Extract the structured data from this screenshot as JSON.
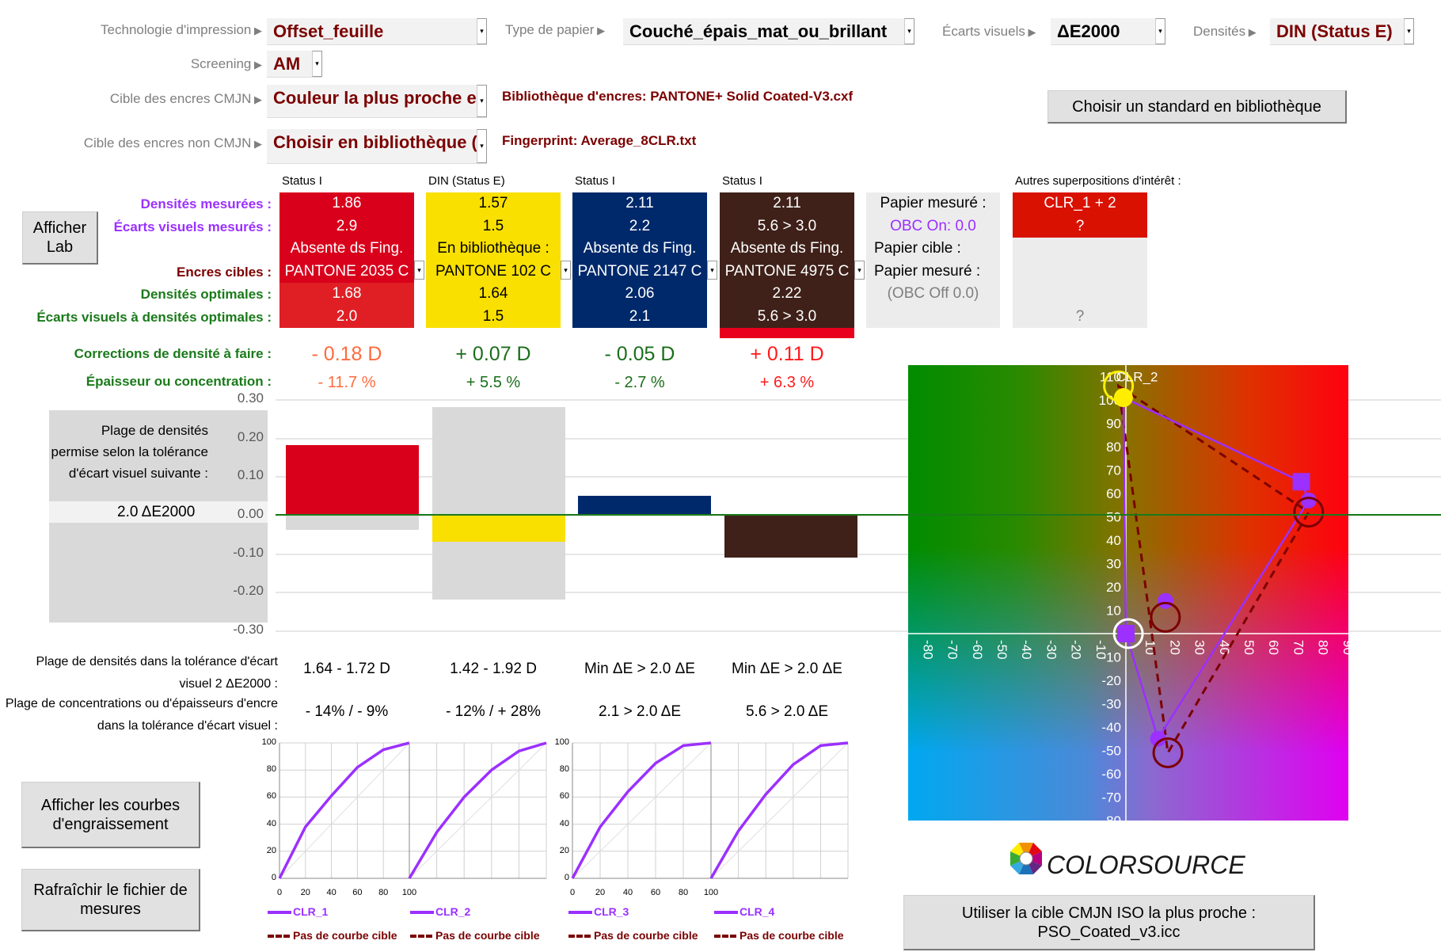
{
  "settings": {
    "tech_label": "Technologie d'impression",
    "tech_value": "Offset_feuille",
    "paper_label": "Type de papier",
    "paper_value": "Couché_épais_mat_ou_brillant",
    "dev_label": "Écarts visuels",
    "dev_value": "ΔE2000",
    "dens_label": "Densités",
    "dens_value": "DIN (Status E)",
    "screen_label": "Screening",
    "screen_value": "AM",
    "cmyk_label": "Cible des encres CMJN",
    "cmyk_value": "Couleur la plus proche e",
    "noncmyk_label": "Cible des encres non CMJN",
    "noncmyk_value": "Choisir en bibliothèque (",
    "library_text": "Bibliothèque d'encres:  PANTONE+ Solid Coated-V3.cxf",
    "fingerprint_text": "Fingerprint: Average_8CLR.txt",
    "choose_standard_button": "Choisir un standard en bibliothèque"
  },
  "buttons": {
    "show_lab": "Afficher Lab",
    "show_curves": "Afficher les courbes d'engraissement",
    "refresh": "Rafraîchir le fichier de mesures",
    "use_iso": "Utiliser la cible CMJN ISO la plus proche : PSO_Coated_v3.icc"
  },
  "row_labels": {
    "measured_density": "Densités mesurées :",
    "measured_dev": "Écarts visuels mesurés :",
    "target_inks": "Encres cibles :",
    "optimal_density": "Densités optimales :",
    "optimal_dev": "Écarts visuels à densités optimales :",
    "corrections": "Corrections de densité à faire :",
    "thickness": "Épaisseur ou concentration :",
    "density_range": "Plage de densités dans la tolérance d'écart visuel 2 ΔE2000 :",
    "conc_range": "Plage de concentrations ou d'épaisseurs d'encre dans la tolérance d'écart visuel :"
  },
  "inks": [
    {
      "status": "Status I",
      "measured_density": "1.86",
      "measured_dev": "2.9",
      "lib_status": "Absente ds Fing.",
      "target": "PANTONE 2035 C",
      "optimal_density": "1.68",
      "optimal_dev": "2.0",
      "correction": "- 0.18 D",
      "thickness": "- 11.7 %",
      "density_range": "1.64 - 1.72 D",
      "conc_range": "- 14% / - 9%",
      "color": "#d9001b",
      "color2": "#e01f25",
      "text_color": "#ffffff",
      "corr_color": "#ff6a3d"
    },
    {
      "status": "DIN (Status E)",
      "measured_density": "1.57",
      "measured_dev": "1.5",
      "lib_status": "En bibliothèque :",
      "target": "PANTONE 102 C",
      "optimal_density": "1.64",
      "optimal_dev": "1.5",
      "correction": "+ 0.07 D",
      "thickness": "+ 5.5 %",
      "density_range": "1.42 - 1.92 D",
      "conc_range": "- 12% / + 28%",
      "color": "#f9e000",
      "color2": "#f9e000",
      "text_color": "#000000",
      "corr_color": "#1a6e1a"
    },
    {
      "status": "Status I",
      "measured_density": "2.11",
      "measured_dev": "2.2",
      "lib_status": "Absente ds Fing.",
      "target": "PANTONE 2147 C",
      "optimal_density": "2.06",
      "optimal_dev": "2.1",
      "correction": "- 0.05 D",
      "thickness": "- 2.7 %",
      "density_range": "Min ΔE > 2.0 ΔE",
      "conc_range": "2.1 > 2.0 ΔE",
      "color": "#00296b",
      "color2": "#00296b",
      "text_color": "#ffffff",
      "corr_color": "#1a6e1a"
    },
    {
      "status": "Status I",
      "measured_density": "2.11",
      "measured_dev": "5.6 > 3.0",
      "lib_status": "Absente ds Fing.",
      "target": "PANTONE 4975 C",
      "optimal_density": "2.22",
      "optimal_dev": "5.6 > 3.0",
      "correction": "+ 0.11 D",
      "thickness": "+ 6.3 %",
      "density_range": "Min ΔE > 2.0 ΔE",
      "conc_range": "5.6 > 2.0 ΔE",
      "color": "#3f2119",
      "color2": "#3f2119",
      "text_color": "#ffffff",
      "corr_color": "#ff1a1a"
    }
  ],
  "paper": {
    "l1": "Papier mesuré :",
    "l2": "OBC On: 0.0",
    "l3": "Papier cible :",
    "l4": "Papier mesuré :",
    "l5": "(OBC Off 0.0)"
  },
  "overprints": {
    "title": "Autres superpositions d'intérêt :",
    "name": "CLR_1 + 2",
    "value": "?",
    "value2": "?"
  },
  "tolerance_box": {
    "text": "Plage de densités permise selon la tolérance d'écart visuel suivante :",
    "value": "2.0 ΔE2000"
  },
  "logo": {
    "text": "COLORSOURCE"
  },
  "chart_data": [
    {
      "type": "bar",
      "yticks": [
        "0.30",
        "0.20",
        "0.10",
        "0.00",
        "-0.10",
        "-0.20",
        "-0.30"
      ],
      "ylim": [
        -0.3,
        0.3
      ],
      "values": [
        0.18,
        -0.07,
        0.05,
        -0.11
      ],
      "ranges": [
        [
          -0.04,
          0
        ],
        [
          -0.22,
          0.28
        ],
        null,
        null
      ],
      "colors": [
        "#d9001b",
        "#f9e000",
        "#00296b",
        "#3f2119"
      ],
      "grid": true
    },
    {
      "type": "scatter",
      "xlim": [
        -90,
        90
      ],
      "ylim": [
        -80,
        115
      ],
      "label": "CLR_2",
      "measured": [
        [
          -1,
          101
        ],
        [
          71,
          65
        ],
        [
          74,
          57
        ],
        [
          13,
          -45
        ],
        [
          0,
          0
        ]
      ],
      "measured_extra": [
        [
          16,
          14
        ]
      ],
      "target": [
        [
          -3,
          106
        ],
        [
          74,
          52
        ],
        [
          17,
          -51
        ]
      ],
      "target_extra": [
        [
          16,
          7
        ]
      ],
      "paper": [
        1,
        0
      ]
    },
    {
      "type": "line",
      "x": [
        0,
        20,
        40,
        60,
        80,
        100
      ],
      "xticks": [
        "0",
        "20",
        "40",
        "60",
        "80",
        "100"
      ],
      "yticks": [
        "0",
        "20",
        "40",
        "60",
        "80",
        "100"
      ],
      "series": [
        {
          "name": "CLR_1",
          "values": [
            0,
            38,
            61,
            82,
            95,
            100
          ]
        },
        {
          "name": "CLR_2",
          "values": [
            0,
            34,
            60,
            80,
            94,
            100
          ]
        },
        {
          "name": "CLR_3",
          "values": [
            0,
            38,
            64,
            85,
            98,
            100
          ]
        },
        {
          "name": "CLR_4",
          "values": [
            0,
            35,
            62,
            84,
            98,
            100
          ]
        }
      ],
      "target_legend": "Pas de courbe cible",
      "curve_color": "#9b30ff"
    }
  ]
}
